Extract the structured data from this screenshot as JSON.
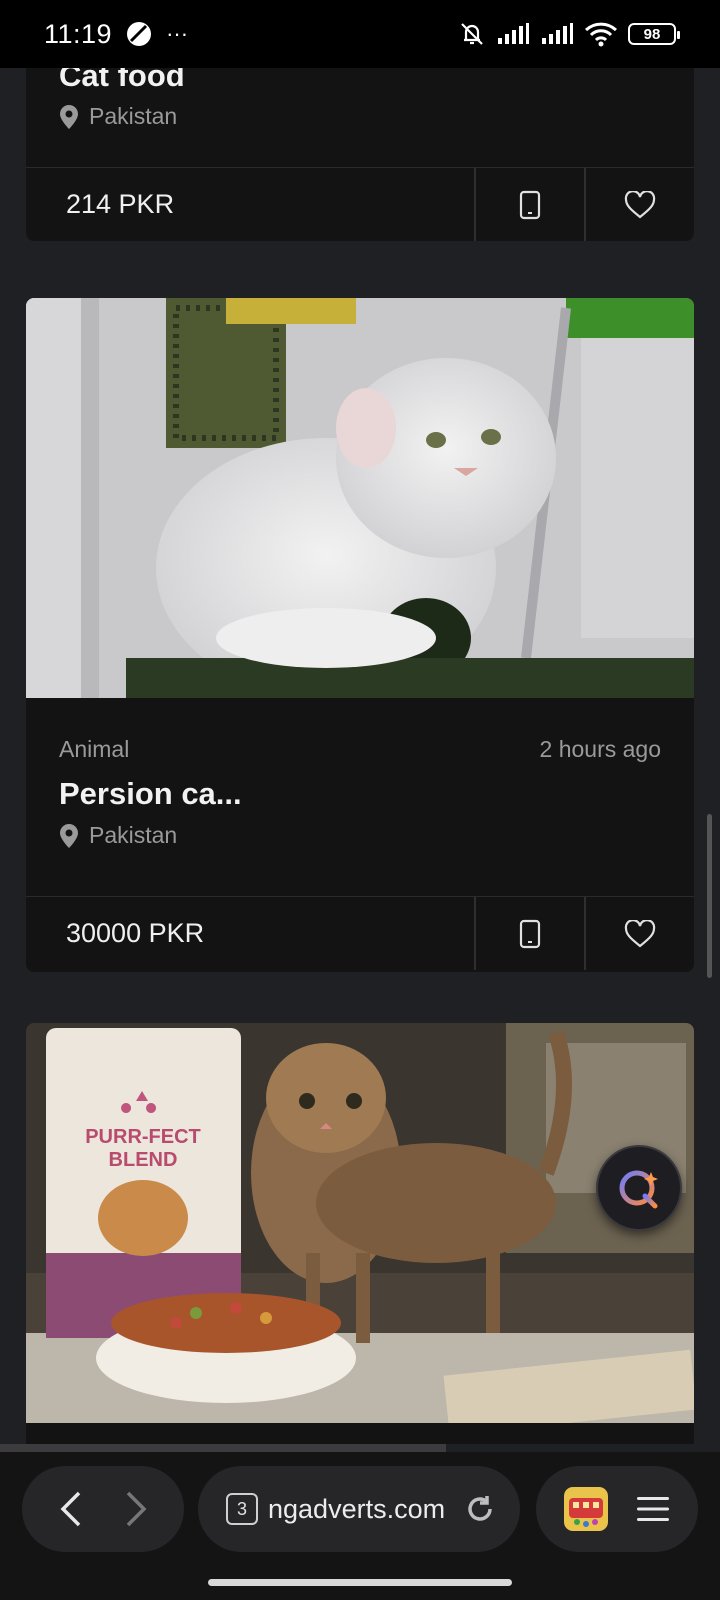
{
  "status_bar": {
    "time": "11:19",
    "more_indicator": "···",
    "battery": "98"
  },
  "cards": [
    {
      "title": "Cat food",
      "location": "Pakistan",
      "price": "214 PKR"
    },
    {
      "category": "Animal",
      "time_ago": "2 hours ago",
      "title": "Persion ca...",
      "location": "Pakistan",
      "price": "30000 PKR"
    },
    {
      "bag_brand_line1": "PURR-FECT",
      "bag_brand_line2": "BLEND"
    }
  ],
  "browser": {
    "tab_count": "3",
    "url": "ngadverts.com",
    "page_load_progress": 0.62
  },
  "icons": {
    "location": "location-pin-icon",
    "phone": "phone-icon",
    "favorite": "heart-icon",
    "assistant": "assistant-q-icon",
    "back": "back-arrow-icon",
    "forward": "forward-arrow-icon",
    "reload": "reload-icon",
    "menu": "hamburger-menu-icon"
  },
  "colors": {
    "background": "#1f2023",
    "card": "#131313",
    "status_bar": "#000000",
    "text_muted": "#9a9a9a",
    "assistant_gradient_start": "#6f7cff",
    "assistant_gradient_end": "#ff8a3c"
  }
}
